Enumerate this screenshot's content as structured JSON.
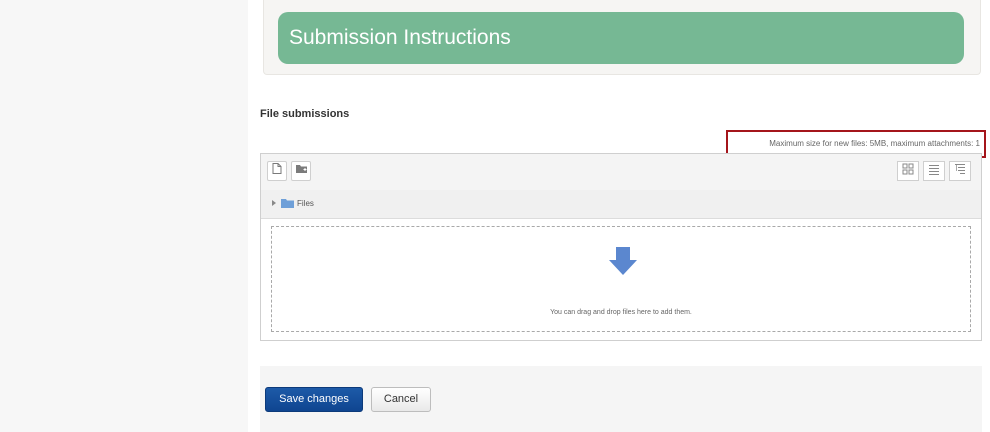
{
  "instructions": {
    "title": "Submission Instructions"
  },
  "file_submissions": {
    "label": "File submissions",
    "limits_text": "Maximum size for new files: 5MB, maximum attachments: 1",
    "toolbar": {
      "add_file_icon": "add-file-icon",
      "create_folder_icon": "create-folder-icon",
      "view_icons": [
        "grid-view-icon",
        "list-view-icon",
        "tree-view-icon"
      ]
    },
    "path": {
      "folder_label": "Files"
    },
    "dropzone": {
      "text": "You can drag and drop files here to add them."
    }
  },
  "actions": {
    "save_label": "Save changes",
    "cancel_label": "Cancel"
  },
  "colors": {
    "header_green": "#76b894",
    "highlight_red": "#a4151b",
    "primary_blue": "#1d5aa8",
    "drop_arrow_blue": "#5b87cf"
  }
}
